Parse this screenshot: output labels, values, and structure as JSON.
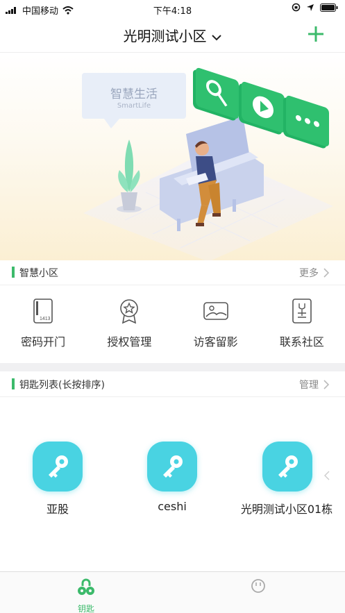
{
  "status": {
    "carrier": "中国移动",
    "time": "下午4:18"
  },
  "header": {
    "title": "光明测试小区",
    "dropdown_icon": "chevron-down-icon",
    "add_icon": "plus-icon",
    "accent": "#3cba6b"
  },
  "banner": {
    "bubble_title": "智慧生活",
    "bubble_subtitle": "SmartLife"
  },
  "smart": {
    "title": "智慧小区",
    "more": "更多",
    "items": [
      {
        "label": "密码开门",
        "icon": "keypad-door-icon"
      },
      {
        "label": "授权管理",
        "icon": "star-badge-icon"
      },
      {
        "label": "访客留影",
        "icon": "photo-icon"
      },
      {
        "label": "联系社区",
        "icon": "contact-community-icon"
      }
    ]
  },
  "keys_section": {
    "title": "钥匙列表(长按排序)",
    "manage": "管理"
  },
  "keys": [
    {
      "name": "亚股"
    },
    {
      "name": "ceshi"
    },
    {
      "name": "光明测试小区01栋"
    }
  ],
  "tabbar": {
    "tabs": [
      {
        "label": "钥匙",
        "active": true
      },
      {
        "label": "",
        "active": false
      }
    ]
  }
}
